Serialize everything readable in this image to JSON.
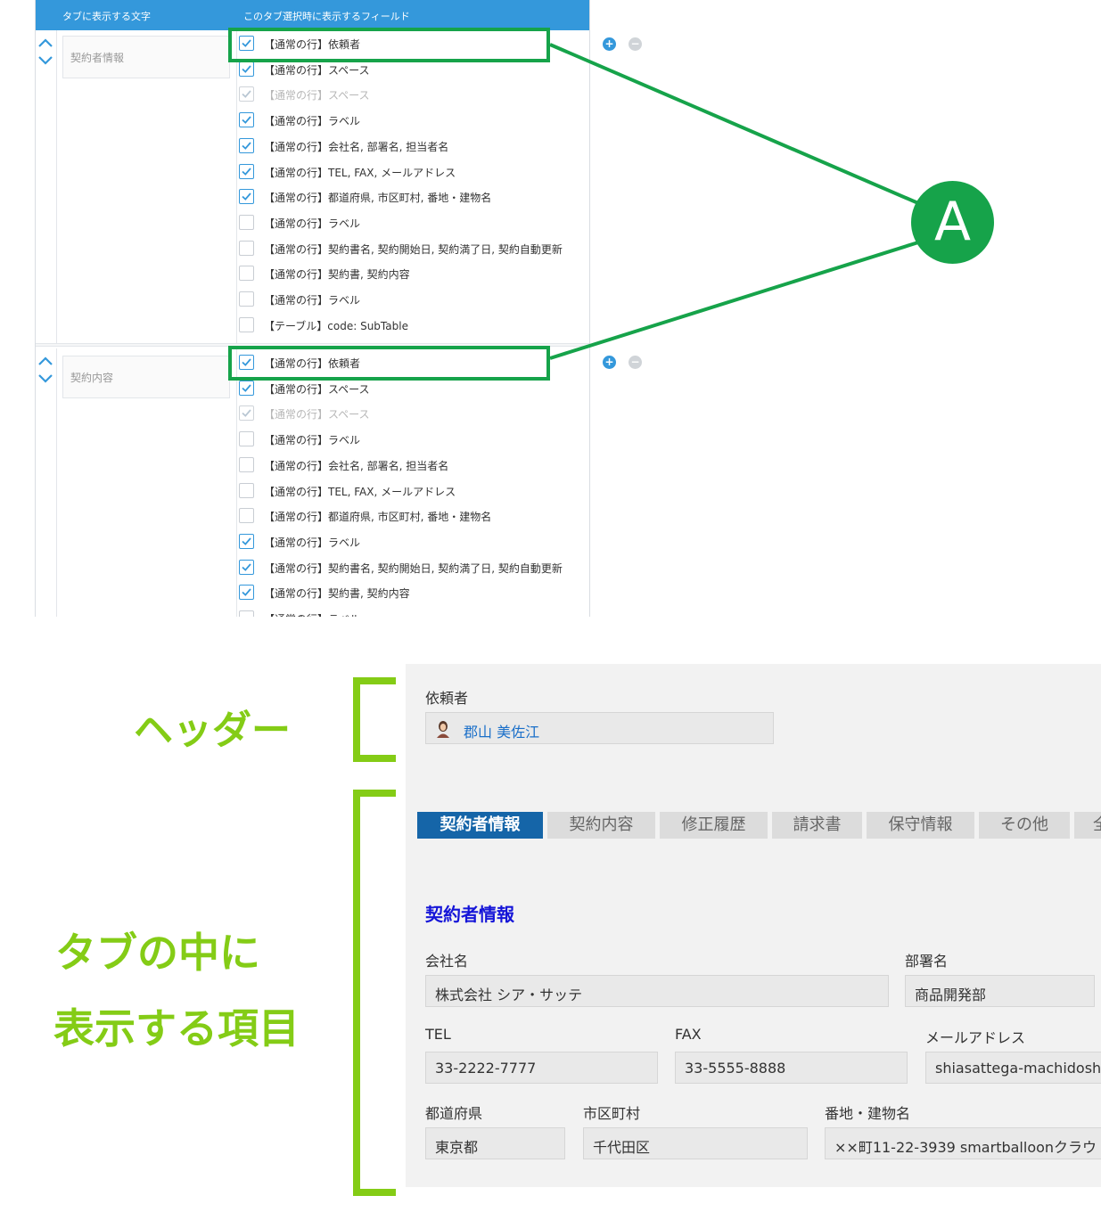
{
  "settings": {
    "header_col1": "タブに表示する文字",
    "header_col2": "このタブ選択時に表示するフィールド",
    "groups": [
      {
        "label": "契約者情報",
        "fields": [
          {
            "text": "【通常の行】依頼者",
            "checked": true,
            "disabled": false
          },
          {
            "text": "【通常の行】スペース",
            "checked": true,
            "disabled": false
          },
          {
            "text": "【通常の行】スペース",
            "checked": true,
            "disabled": true
          },
          {
            "text": "【通常の行】ラベル",
            "checked": true,
            "disabled": false
          },
          {
            "text": "【通常の行】会社名, 部署名, 担当者名",
            "checked": true,
            "disabled": false
          },
          {
            "text": "【通常の行】TEL, FAX, メールアドレス",
            "checked": true,
            "disabled": false
          },
          {
            "text": "【通常の行】都道府県, 市区町村, 番地・建物名",
            "checked": true,
            "disabled": false
          },
          {
            "text": "【通常の行】ラベル",
            "checked": false,
            "disabled": false
          },
          {
            "text": "【通常の行】契約書名, 契約開始日, 契約満了日, 契約自動更新",
            "checked": false,
            "disabled": false
          },
          {
            "text": "【通常の行】契約書, 契約内容",
            "checked": false,
            "disabled": false
          },
          {
            "text": "【通常の行】ラベル",
            "checked": false,
            "disabled": false
          },
          {
            "text": "【テーブル】code: SubTable",
            "checked": false,
            "disabled": false
          }
        ]
      },
      {
        "label": "契約内容",
        "fields": [
          {
            "text": "【通常の行】依頼者",
            "checked": true,
            "disabled": false
          },
          {
            "text": "【通常の行】スペース",
            "checked": true,
            "disabled": false
          },
          {
            "text": "【通常の行】スペース",
            "checked": true,
            "disabled": true
          },
          {
            "text": "【通常の行】ラベル",
            "checked": false,
            "disabled": false
          },
          {
            "text": "【通常の行】会社名, 部署名, 担当者名",
            "checked": false,
            "disabled": false
          },
          {
            "text": "【通常の行】TEL, FAX, メールアドレス",
            "checked": false,
            "disabled": false
          },
          {
            "text": "【通常の行】都道府県, 市区町村, 番地・建物名",
            "checked": false,
            "disabled": false
          },
          {
            "text": "【通常の行】ラベル",
            "checked": true,
            "disabled": false
          },
          {
            "text": "【通常の行】契約書名, 契約開始日, 契約満了日, 契約自動更新",
            "checked": true,
            "disabled": false
          },
          {
            "text": "【通常の行】契約書, 契約内容",
            "checked": true,
            "disabled": false
          },
          {
            "text": "【通常の行】ラベル",
            "checked": false,
            "disabled": false
          }
        ]
      }
    ]
  },
  "callout": {
    "label": "A",
    "color": "#16a34a"
  },
  "annotations": {
    "header": "ヘッダー",
    "tab_items_line1": "タブの中に",
    "tab_items_line2": "表示する項目",
    "color": "#84cc16"
  },
  "preview": {
    "requester_label": "依頼者",
    "requester_value": "郡山 美佐江",
    "tabs": [
      "契約者情報",
      "契約内容",
      "修正履歴",
      "請求書",
      "保守情報",
      "その他",
      "全"
    ],
    "active_tab_index": 0,
    "section_title": "契約者情報",
    "company_label": "会社名",
    "company_value": "株式会社 シア・サッテ",
    "dept_label": "部署名",
    "dept_value": "商品開発部",
    "tel_label": "TEL",
    "tel_value": "33-2222-7777",
    "fax_label": "FAX",
    "fax_value": "33-5555-8888",
    "mail_label": "メールアドレス",
    "mail_value": "shiasattega-machidoshi",
    "pref_label": "都道府県",
    "pref_value": "東京都",
    "city_label": "市区町村",
    "city_value": "千代田区",
    "addr_label": "番地・建物名",
    "addr_value": "××町11-22-3939 smartballoonクラウ",
    "accent_color": "#1565a8",
    "title_color": "#1515d8",
    "link_color": "#1a6fc9"
  }
}
